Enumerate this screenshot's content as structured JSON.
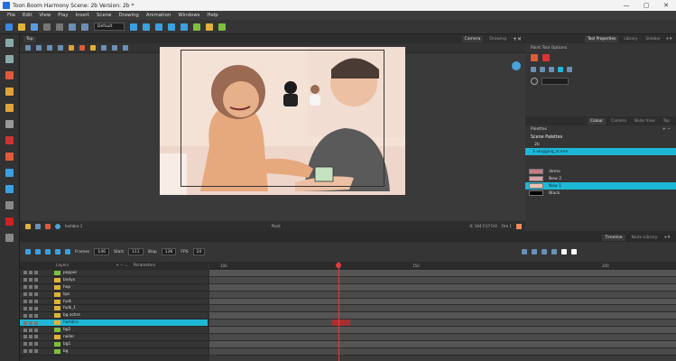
{
  "window": {
    "title": "Toon Boom Harmony Scene: 2b Version: 2b *",
    "controls": [
      "—",
      "▢",
      "✕"
    ]
  },
  "menu": [
    "File",
    "Edit",
    "View",
    "Play",
    "Insert",
    "Scene",
    "Drawing",
    "Animation",
    "Windows",
    "Help"
  ],
  "toolbar": {
    "preset_label": "Default"
  },
  "camera_panel": {
    "top_tab": "Top",
    "tabs": [
      "Camera",
      "Drawing"
    ],
    "status": {
      "layer": "hombro 1",
      "mode": "Paint",
      "coords": "X: 144  Y:17  0:0",
      "frame": "Frm 1"
    }
  },
  "right_panel": {
    "top_tabs": [
      "Tool Properties",
      "Library",
      "Sidebar"
    ],
    "title": "Paint Tool Options",
    "colour_tabs": [
      "Colour",
      "Camera",
      "Node View",
      "Top"
    ],
    "palettes_label": "Palettes",
    "scene_palettes_label": "Scene Palettes",
    "palette_root": "2b",
    "palette_selected": "1-vlogging_scene",
    "swatches": [
      {
        "name": "demo",
        "color": "#c97b86"
      },
      {
        "name": "New 2",
        "color": "#d8a0a6"
      },
      {
        "name": "New 1",
        "color": "#e7c3b3"
      },
      {
        "name": "Black",
        "color": "#000000"
      }
    ]
  },
  "timeline": {
    "tabs": [
      "Timeline",
      "Node Library"
    ],
    "frames_label": "Frames",
    "frames_value": "146",
    "start_label": "Start",
    "start_value": "111",
    "stop_label": "Stop",
    "stop_value": "136",
    "fps_label": "FPS",
    "fps_value": "24",
    "layers_header": {
      "layers": "Layers",
      "parameters": "Parameters"
    },
    "ruler": [
      "100",
      "150",
      "200"
    ],
    "layers": [
      {
        "name": "pepper",
        "selected": false
      },
      {
        "name": "bodyx",
        "selected": false
      },
      {
        "name": "hep",
        "selected": false
      },
      {
        "name": "lips",
        "selected": false
      },
      {
        "name": "hulk",
        "selected": false
      },
      {
        "name": "hulk_1",
        "selected": false
      },
      {
        "name": "bg ochre",
        "selected": false
      },
      {
        "name": "hombro",
        "selected": true
      },
      {
        "name": "bg2",
        "selected": false
      },
      {
        "name": "nailer",
        "selected": false
      },
      {
        "name": "bg1",
        "selected": false
      },
      {
        "name": "bg",
        "selected": false
      }
    ]
  },
  "colors": {
    "accent": "#1fb7d6",
    "playhead": "#e23b3b",
    "stage_bg": "#f4e2d7"
  }
}
